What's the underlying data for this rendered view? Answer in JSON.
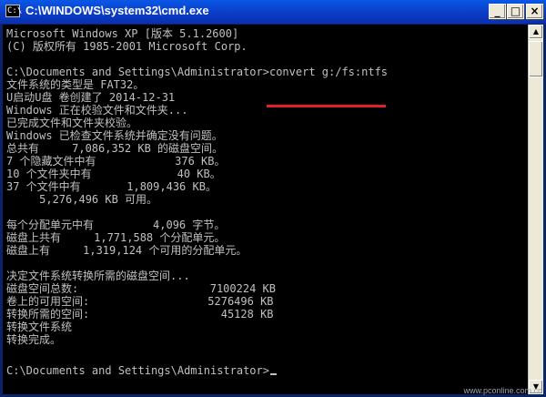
{
  "window": {
    "title": "C:\\WINDOWS\\system32\\cmd.exe",
    "icon_text": "C:\\",
    "minimize_glyph": "_",
    "maximize_glyph": "□",
    "close_glyph": "×"
  },
  "console": {
    "lines": [
      "Microsoft Windows XP [版本 5.1.2600]",
      "(C) 版权所有 1985-2001 Microsoft Corp.",
      "",
      "C:\\Documents and Settings\\Administrator>convert g:/fs:ntfs",
      "文件系统的类型是 FAT32。",
      "U启动U盘 卷创建了 2014-12-31",
      "Windows 正在校验文件和文件夹...",
      "已完成文件和文件夹校验。",
      "Windows 已检查文件系统并确定没有问题。",
      "总共有     7,086,352 KB 的磁盘空间。",
      "7 个隐藏文件中有            376 KB。",
      "10 个文件夹中有             40 KB。",
      "37 个文件中有       1,809,436 KB。",
      "     5,276,496 KB 可用。",
      "",
      "每个分配单元中有         4,096 字节。",
      "磁盘上共有     1,771,588 个分配单元。",
      "磁盘上有     1,319,124 个可用的分配单元。",
      "",
      "决定文件系统转换所需的磁盘空间...",
      "磁盘空间总数:                    7100224 KB",
      "卷上的可用空间:                  5276496 KB",
      "转换所需的空间:                    45128 KB",
      "转换文件系统",
      "转换完成。",
      "",
      "C:\\Documents and Settings\\Administrator>"
    ]
  },
  "scrollbar": {
    "up_glyph": "▲",
    "down_glyph": "▼"
  },
  "watermark": "www.pconline.com.cn",
  "colors": {
    "console_bg": "#000000",
    "console_text": "#c0c0c0",
    "highlight_underline": "#e0202a",
    "titlebar": "#0b3cc5"
  }
}
